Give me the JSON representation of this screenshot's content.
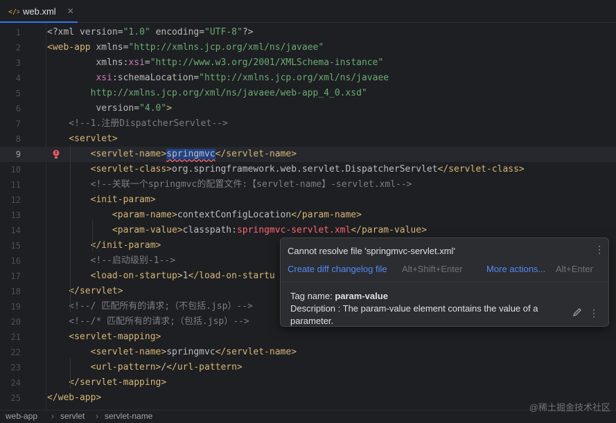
{
  "tab": {
    "file_name": "web.xml",
    "close_glyph": "✕",
    "accent": "#3574f0"
  },
  "lines": [
    {
      "n": "1",
      "tokens": [
        [
          "t-text",
          "<?xml "
        ],
        [
          "t-attr",
          "version"
        ],
        [
          "t-text",
          "="
        ],
        [
          "t-val",
          "\"1.0\""
        ],
        [
          "t-text",
          " "
        ],
        [
          "t-attr",
          "encoding"
        ],
        [
          "t-text",
          "="
        ],
        [
          "t-val",
          "\"UTF-8\""
        ],
        [
          "t-text",
          "?>"
        ]
      ]
    },
    {
      "n": "2",
      "tokens": [
        [
          "t-tag",
          "<web-app "
        ],
        [
          "t-attr",
          "xmlns"
        ],
        [
          "t-text",
          "="
        ],
        [
          "t-val",
          "\"http://xmlns.jcp.org/xml/ns/javaee\""
        ]
      ]
    },
    {
      "n": "3",
      "tokens": [
        [
          "t-text",
          "         "
        ],
        [
          "t-attr",
          "xmlns"
        ],
        [
          "t-text",
          ":"
        ],
        [
          "t-ns",
          "xsi"
        ],
        [
          "t-text",
          "="
        ],
        [
          "t-val",
          "\"http://www.w3.org/2001/XMLSchema-instance\""
        ]
      ]
    },
    {
      "n": "4",
      "tokens": [
        [
          "t-text",
          "         "
        ],
        [
          "t-ns",
          "xsi"
        ],
        [
          "t-text",
          ":"
        ],
        [
          "t-attr",
          "schemaLocation"
        ],
        [
          "t-text",
          "="
        ],
        [
          "t-val",
          "\"http://xmlns.jcp.org/xml/ns/javaee"
        ]
      ]
    },
    {
      "n": "5",
      "tokens": [
        [
          "t-val",
          "        http://xmlns.jcp.org/xml/ns/javaee/web-app_4_0.xsd\""
        ]
      ]
    },
    {
      "n": "6",
      "tokens": [
        [
          "t-text",
          "         "
        ],
        [
          "t-attr",
          "version"
        ],
        [
          "t-text",
          "="
        ],
        [
          "t-val",
          "\"4.0\""
        ],
        [
          "t-tag",
          ">"
        ]
      ]
    },
    {
      "n": "7",
      "tokens": [
        [
          "t-com",
          "    <!--1.注册DispatcherServlet-->"
        ]
      ]
    },
    {
      "n": "8",
      "tokens": [
        [
          "t-tag",
          "    <servlet>"
        ]
      ]
    },
    {
      "n": "9",
      "current": true,
      "error": true,
      "tokens": [
        [
          "t-tag",
          "        <servlet-name>"
        ],
        [
          "t-hl",
          "springmvc"
        ],
        [
          "t-tag",
          "</servlet-name>"
        ]
      ]
    },
    {
      "n": "10",
      "tokens": [
        [
          "t-tag",
          "        <servlet-class>"
        ],
        [
          "t-text",
          "org.springframework.web.servlet.DispatcherServlet"
        ],
        [
          "t-tag",
          "</servlet-class>"
        ]
      ]
    },
    {
      "n": "11",
      "tokens": [
        [
          "t-com",
          "        <!--关联一个springmvc的配置文件:【servlet-name】-servlet.xml-->"
        ]
      ]
    },
    {
      "n": "12",
      "tokens": [
        [
          "t-tag",
          "        <init-param>"
        ]
      ]
    },
    {
      "n": "13",
      "tokens": [
        [
          "t-tag",
          "            <param-name>"
        ],
        [
          "t-text",
          "contextConfigLocation"
        ],
        [
          "t-tag",
          "</param-name>"
        ]
      ]
    },
    {
      "n": "14",
      "tokens": [
        [
          "t-tag",
          "            <param-value>"
        ],
        [
          "t-text",
          "classpath:"
        ],
        [
          "t-err",
          "springmvc-servlet.xml"
        ],
        [
          "t-tag",
          "</param-value>"
        ]
      ]
    },
    {
      "n": "15",
      "tokens": [
        [
          "t-tag",
          "        </init-param>"
        ]
      ]
    },
    {
      "n": "16",
      "tokens": [
        [
          "t-com",
          "        <!--启动级别-1-->"
        ]
      ]
    },
    {
      "n": "17",
      "tokens": [
        [
          "t-tag",
          "        <load-on-startup>"
        ],
        [
          "t-text",
          "1"
        ],
        [
          "t-tag",
          "</load-on-startu"
        ]
      ]
    },
    {
      "n": "18",
      "tokens": [
        [
          "t-tag",
          "    </servlet>"
        ]
      ]
    },
    {
      "n": "19",
      "tokens": [
        [
          "t-com",
          "    <!--/ 匹配所有的请求;（不包括.jsp）-->"
        ]
      ]
    },
    {
      "n": "20",
      "tokens": [
        [
          "t-com",
          "    <!--/* 匹配所有的请求;（包括.jsp）-->"
        ]
      ]
    },
    {
      "n": "21",
      "tokens": [
        [
          "t-tag",
          "    <servlet-mapping>"
        ]
      ]
    },
    {
      "n": "22",
      "tokens": [
        [
          "t-tag",
          "        <servlet-name>"
        ],
        [
          "t-text",
          "springmvc"
        ],
        [
          "t-tag",
          "</servlet-name>"
        ]
      ]
    },
    {
      "n": "23",
      "tokens": [
        [
          "t-tag",
          "        <url-pattern>"
        ],
        [
          "t-text",
          "/"
        ],
        [
          "t-tag",
          "</url-pattern>"
        ]
      ]
    },
    {
      "n": "24",
      "tokens": [
        [
          "t-tag",
          "    </servlet-mapping>"
        ]
      ]
    },
    {
      "n": "25",
      "tokens": [
        [
          "t-tag",
          "</web-app>"
        ]
      ]
    }
  ],
  "popup": {
    "title": "Cannot resolve file 'springmvc-servlet.xml'",
    "action1": "Create diff changelog file",
    "action1_shortcut": "Alt+Shift+Enter",
    "action2": "More actions...",
    "action2_shortcut": "Alt+Enter",
    "tag_label": "Tag name: ",
    "tag_name": "param-value",
    "description": "Description : The param-value element contains the value of a parameter.",
    "kebab_glyph": "⋮"
  },
  "breadcrumbs": [
    "web-app",
    "servlet",
    "servlet-name"
  ],
  "breadcrumb_sep": "›",
  "watermark": "@稀土掘金技术社区"
}
